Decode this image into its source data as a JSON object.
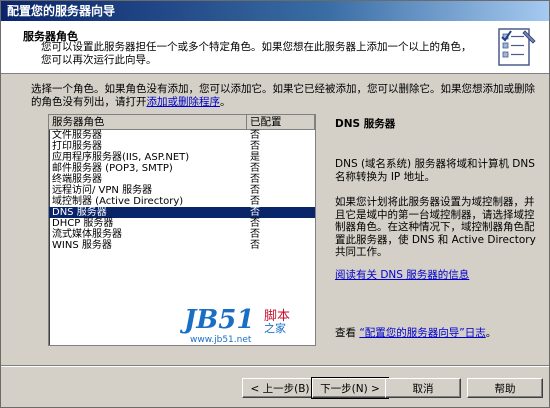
{
  "window": {
    "title": "配置您的服务器向导"
  },
  "header": {
    "title": "服务器角色",
    "description": "您可以设置此服务器担任一个或多个特定角色。如果您想在此服务器上添加一个以上的角色，您可以再次运行此向导。"
  },
  "instruction": {
    "text": "选择一个角色。如果角色没有添加，您可以添加它。如果它已经被添加，您可以删除它。如果您想添加或删除的角色没有列出，请打开",
    "link": "添加或删除程序",
    "suffix": "。"
  },
  "list": {
    "columns": [
      "服务器角色",
      "已配置"
    ],
    "rows": [
      {
        "role": "文件服务器",
        "configured": "否"
      },
      {
        "role": "打印服务器",
        "configured": "否"
      },
      {
        "role": "应用程序服务器(IIS, ASP.NET)",
        "configured": "是"
      },
      {
        "role": "邮件服务器 (POP3, SMTP)",
        "configured": "否"
      },
      {
        "role": "终端服务器",
        "configured": "否"
      },
      {
        "role": "远程访问/ VPN 服务器",
        "configured": "否"
      },
      {
        "role": "域控制器 (Active Directory)",
        "configured": "否"
      },
      {
        "role": "DNS 服务器",
        "configured": "否"
      },
      {
        "role": "DHCP 服务器",
        "configured": "否"
      },
      {
        "role": "流式媒体服务器",
        "configured": "否"
      },
      {
        "role": "WINS 服务器",
        "configured": "否"
      }
    ],
    "selected_index": 7
  },
  "detail": {
    "title": "DNS 服务器",
    "p1": "DNS (域名系统) 服务器将域和计算机 DNS 名称转换为 IP 地址。",
    "p2": "如果您计划将此服务器设置为域控制器，并且它是域中的第一台域控制器，请选择域控制器角色。在这种情况下，域控制器角色配置此服务器，使 DNS 和 Active Directory 共同工作。",
    "more_link": "阅读有关 DNS 服务器的信息",
    "log_prefix": "查看",
    "log_link": "“配置您的服务器向导”日志",
    "log_suffix": "。"
  },
  "watermark": {
    "logo": "JB51",
    "line1": "脚本",
    "line2": "之家",
    "url": "www.jb51.net"
  },
  "buttons": {
    "back": "< 上一步(B)",
    "next": "下一步(N) >",
    "cancel": "取消",
    "help": "帮助"
  },
  "colors": {
    "title_bar": "#0a246a",
    "selection": "#0a246a",
    "link": "#0000cc"
  }
}
